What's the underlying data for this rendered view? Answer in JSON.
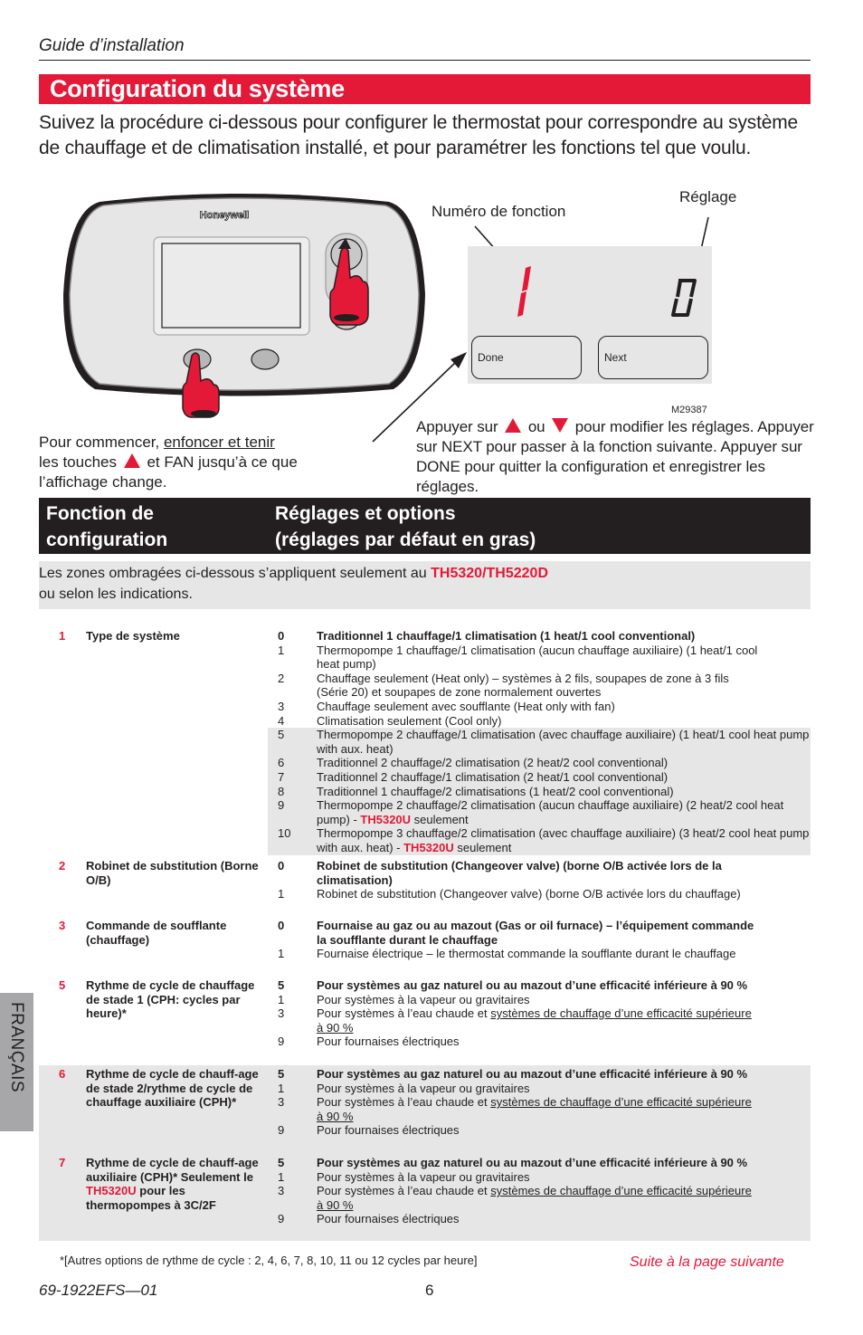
{
  "header": {
    "running_head": "Guide d’installation",
    "section_title": "Configuration du système",
    "intro": "Suivez la procédure ci-dessous pour configurer le thermostat pour correspondre au système de chauffage et de climatisation installé, et pour paramétrer les fonctions tel que voulu."
  },
  "figure": {
    "brand": "Honeywell",
    "label_function_number": "Numéro de fonction",
    "label_setting": "Réglage",
    "display_function_digit": "1",
    "display_setting_digit": "0",
    "button_done": "Done",
    "button_next": "Next",
    "figure_code": "M29387",
    "accent_color": "#e31937"
  },
  "instructions": {
    "left_pre": "Pour commencer, ",
    "left_underlined": "enfoncer et tenir",
    "left_mid": "les touches",
    "left_post": "et FAN jusqu’à ce que l’affichage change.",
    "right_pre": "Appuyer sur",
    "right_or": "ou",
    "right_post": "pour modifier les réglages. Appuyer sur NEXT pour passer à la fonction suivante. Appuyer sur DONE pour quitter la configuration et enregistrer les réglages."
  },
  "table": {
    "col1_header": [
      "Fonction de",
      "configuration"
    ],
    "col2_header": [
      "Réglages et options",
      "(réglages par défaut en gras)"
    ],
    "shade_note_pre": "Les zones ombragées ci-dessous s’appliquent seulement au ",
    "shade_note_model": "TH5320/TH5220D",
    "shade_note_post": "ou selon les indications.",
    "rows": [
      {
        "num": "1",
        "name": "Type de système",
        "options": [
          {
            "k": "0",
            "text": "Traditionnel 1 chauffage/1 climatisation (1 heat/1 cool conventional)",
            "bold": true
          },
          {
            "k": "1",
            "text": "Thermopompe 1 chauffage/1 climatisation (aucun chauffage auxiliaire) (1 heat/1 cool heat pump)"
          },
          {
            "k": "2",
            "text": "Chauffage seulement (Heat only) – systèmes à 2 fils, soupapes de zone à 3 fils (Série 20) et soupapes de zone normalement ouvertes"
          },
          {
            "k": "3",
            "text": "Chauffage seulement avec soufflante (Heat only with fan)"
          },
          {
            "k": "4",
            "text": "Climatisation seulement (Cool only)"
          },
          {
            "k": "5",
            "text": "Thermopompe 2 chauffage/1 climatisation (avec chauffage auxiliaire) (1 heat/1 cool heat pump with aux. heat)",
            "shaded": true
          },
          {
            "k": "6",
            "text": "Traditionnel 2 chauffage/2 climatisation (2 heat/2 cool conventional)",
            "shaded": true
          },
          {
            "k": "7",
            "text": "Traditionnel 2 chauffage/1 climatisation (2 heat/1 cool conventional)",
            "shaded": true
          },
          {
            "k": "8",
            "text": "Traditionnel 1 chauffage/2 climatisations (1 heat/2 cool conventional)",
            "shaded": true
          },
          {
            "k": "9",
            "text": "Thermopompe 2 chauffage/2 climatisation (aucun chauffage auxiliaire) (2 heat/2 cool heat pump) - ",
            "model": "TH5320U",
            "suffix": " seulement",
            "shaded": true
          },
          {
            "k": "10",
            "text": "Thermopompe 3 chauffage/2 climatisation (avec chauffage auxiliaire) (3 heat/2 cool heat pump with aux. heat) - ",
            "model": "TH5320U",
            "suffix": " seulement",
            "shaded": true
          }
        ]
      },
      {
        "num": "2",
        "name": "Robinet de substitution (Borne O/B)",
        "options": [
          {
            "k": "0",
            "text": "Robinet de substitution (Changeover valve) (borne O/B activée lors de la climatisation)",
            "bold": true
          },
          {
            "k": "1",
            "text": "Robinet de substitution (Changeover valve) (borne O/B activée lors du chauffage)"
          }
        ]
      },
      {
        "num": "3",
        "name": "Commande de soufflante (chauffage)",
        "options": [
          {
            "k": "0",
            "text": "Fournaise au gaz ou au mazout (Gas or oil furnace) – l’équipement commande la soufflante durant le chauffage",
            "bold": true
          },
          {
            "k": "1",
            "text": "Fournaise électrique – le thermostat commande la soufflante durant le chauffage"
          }
        ]
      },
      {
        "num": "5",
        "name": "Rythme de cycle de chauffage de stade 1 (CPH: cycles par heure)*",
        "options": [
          {
            "k": "5",
            "text": "Pour systèmes au gaz naturel ou au mazout d’une efficacité inférieure à 90 %",
            "bold": true
          },
          {
            "k": "1",
            "text": "Pour systèmes à la vapeur ou gravitaires"
          },
          {
            "k": "3",
            "text": "Pour systèmes à l’eau chaude et ",
            "underlined": "systèmes de chauffage d’une efficacité supérieure à 90 %"
          },
          {
            "k": "9",
            "text": "Pour fournaises électriques"
          }
        ]
      },
      {
        "num": "6",
        "name": "Rythme de cycle de chauff-age de stade 2/rythme de cycle de chauffage auxiliaire (CPH)*",
        "shaded": true,
        "options": [
          {
            "k": "5",
            "text": "Pour systèmes au gaz naturel ou au mazout d’une efficacité inférieure à 90 %",
            "bold": true
          },
          {
            "k": "1",
            "text": "Pour systèmes à la vapeur ou gravitaires"
          },
          {
            "k": "3",
            "text": "Pour systèmes à l’eau chaude et ",
            "underlined": "systèmes de chauffage d’une efficacité supérieure à 90 %"
          },
          {
            "k": "9",
            "text": "Pour fournaises électriques"
          }
        ]
      },
      {
        "num": "7",
        "name_pre": "Rythme de cycle de chauff-age auxiliaire (CPH)* Seulement le ",
        "name_model": "TH5320U",
        "name_post": " pour les thermopompes à 3C/2F",
        "shaded": true,
        "options": [
          {
            "k": "5",
            "text": "Pour systèmes au gaz naturel ou au mazout d’une efficacité inférieure à 90 %",
            "bold": true
          },
          {
            "k": "1",
            "text": "Pour systèmes à la vapeur ou gravitaires"
          },
          {
            "k": "3",
            "text": "Pour systèmes à l’eau chaude et ",
            "underlined": "systèmes de chauffage d’une efficacité supérieure à 90 %"
          },
          {
            "k": "9",
            "text": "Pour fournaises électriques"
          }
        ]
      }
    ]
  },
  "footer": {
    "footnote": "*[Autres options de rythme de cycle : 2, 4, 6, 7, 8, 10, 11 ou 12 cycles par heure]",
    "continued": "Suite à la page suivante",
    "doc_number": "69-1922EFS—01",
    "page_number": "6",
    "language_tab": "FRANÇAIS"
  }
}
